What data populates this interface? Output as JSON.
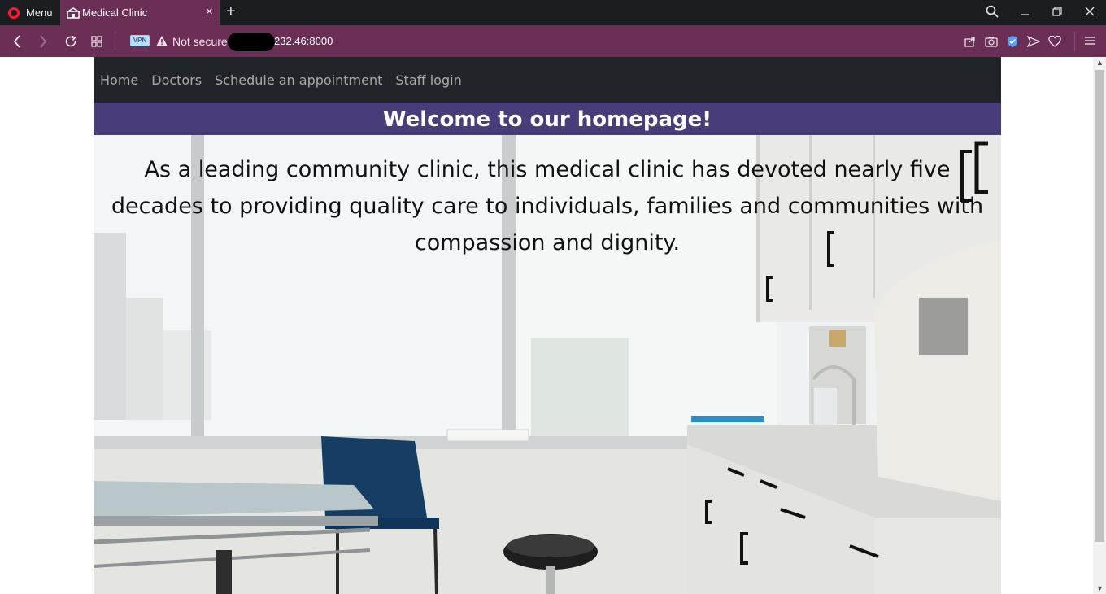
{
  "browser": {
    "menu_label": "Menu",
    "tab_title": "Medical Clinic",
    "tab_close": "×",
    "new_tab": "+",
    "security_label": "Not secure",
    "vpn_label": "VPN",
    "url_visible": "232.46:8000",
    "window_controls": [
      "minimize",
      "restore",
      "close"
    ],
    "accent_color": "#6b2e55"
  },
  "site": {
    "nav": {
      "home": "Home",
      "doctors": "Doctors",
      "appointment": "Schedule an appointment",
      "staff_login": "Staff login"
    },
    "welcome_heading": "Welcome to our homepage!",
    "intro_text": "As a leading community clinic, this medical clinic has devoted nearly five decades to providing quality care to individuals, families and communities with compassion and dignity.",
    "header_color": "#483d7a",
    "nav_color": "#212529"
  }
}
